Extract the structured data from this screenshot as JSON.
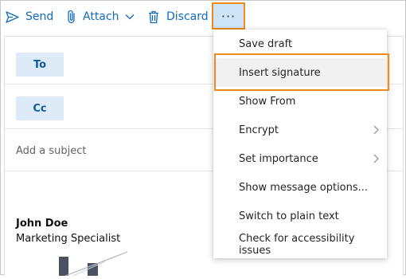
{
  "toolbar": {
    "send_label": "Send",
    "attach_label": "Attach",
    "discard_label": "Discard",
    "more_label": "···",
    "icons": [
      "send-icon",
      "paperclip-icon",
      "chevron-down-icon",
      "trash-icon"
    ]
  },
  "compose": {
    "to_label": "To",
    "cc_label": "Cc",
    "subject_placeholder": "Add a subject",
    "signature": {
      "name": "John Doe",
      "title": "Marketing Specialist"
    }
  },
  "menu": {
    "items": [
      {
        "label": "Save draft",
        "submenu": false,
        "highlighted": false
      },
      {
        "label": "Insert signature",
        "submenu": false,
        "highlighted": true
      },
      {
        "label": "Show From",
        "submenu": false,
        "highlighted": false
      },
      {
        "label": "Encrypt",
        "submenu": true,
        "highlighted": false
      },
      {
        "label": "Set importance",
        "submenu": true,
        "highlighted": false
      },
      {
        "label": "Show message options...",
        "submenu": false,
        "highlighted": false
      },
      {
        "label": "Switch to plain text",
        "submenu": false,
        "highlighted": false
      },
      {
        "label": "Check for accessibility issues",
        "submenu": false,
        "highlighted": false
      }
    ]
  },
  "colors": {
    "accent": "#0f6cbd",
    "highlight_outline": "#f08a1c",
    "recipient_button_bg": "#ddeaf7"
  }
}
